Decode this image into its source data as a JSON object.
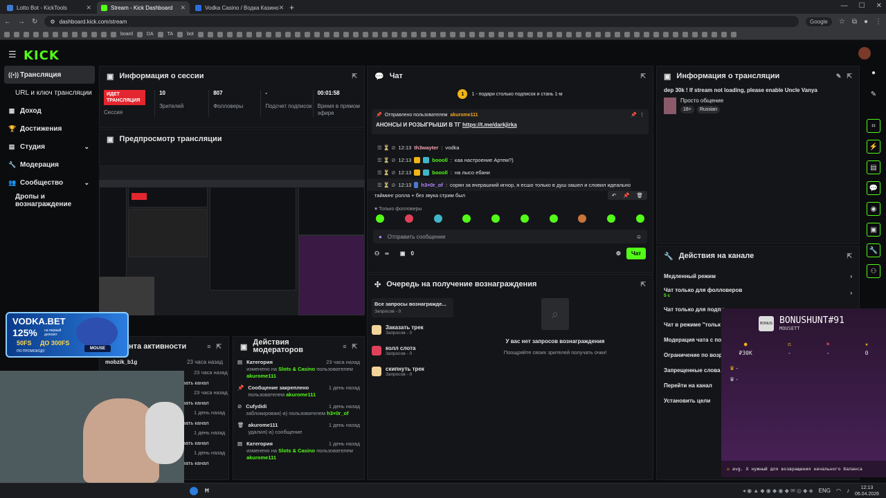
{
  "browser": {
    "tabs": [
      {
        "label": "Lotto Bot - KickTools",
        "color": "#3a7bd5"
      },
      {
        "label": "Stream - Kick Dashboard",
        "color": "#53fc18"
      },
      {
        "label": "Vodka Casino / Водка Казино",
        "color": "#2b6de0"
      }
    ],
    "url": "dashboard.kick.com/stream",
    "search_engine": "Google",
    "bookmarks": [
      "board",
      "DA",
      "TA",
      "bot"
    ]
  },
  "kick": {
    "logo": "KICK"
  },
  "sidebar": {
    "items": [
      {
        "label": "Трансляция",
        "icon": "broadcast-icon",
        "active": true
      },
      {
        "label": "URL и ключ трансляции",
        "icon": "",
        "active": false
      },
      {
        "label": "Доход",
        "icon": "chart-icon",
        "active": false
      },
      {
        "label": "Достижения",
        "icon": "trophy-icon",
        "active": false
      },
      {
        "label": "Студия",
        "icon": "studio-icon",
        "active": false,
        "expand": true
      },
      {
        "label": "Модерация",
        "icon": "wrench-icon",
        "active": false
      },
      {
        "label": "Сообщество",
        "icon": "community-icon",
        "active": false,
        "expand": true
      },
      {
        "label": "Дропы и вознаграждение",
        "icon": "",
        "active": false
      }
    ]
  },
  "session": {
    "title": "Информация о сессии",
    "live_label": "ИДЕТ ТРАНСЛЯЦИЯ",
    "session_label": "Сессия",
    "viewers": "10",
    "viewers_label": "Зрителей",
    "followers": "807",
    "followers_label": "Фолловеры",
    "subs": "-",
    "subs_label": "Подсчет подписок",
    "uptime": "00:01:58",
    "uptime_label": "Время в прямом эфире"
  },
  "preview": {
    "title": "Предпросмотр трансляции"
  },
  "chat": {
    "title": "Чат",
    "goal_text": "1 - подари столько подписок и стань 1-м",
    "goal_num": "1",
    "pinned_by_label": "Отправлено пользователем",
    "pinned_user": "akurome111",
    "pinned_text": "АНОНСЫ И РОЗЫГРЫШИ В ТГ",
    "pinned_link": "https://t.me/darkjirka",
    "messages": [
      {
        "time": "12:13",
        "user": "th3wayter",
        "text": "vodka",
        "color": "#f5a3b5"
      },
      {
        "time": "12:13",
        "user": "boooll",
        "text": "каа настроение Артем?)",
        "color": "#53fc18"
      },
      {
        "time": "12:13",
        "user": "boooll",
        "text": "на лысо ебани",
        "color": "#53fc18"
      },
      {
        "time": "12:13",
        "user": "h3×0r_of",
        "text": "сорян за вчерашний игнор, я есшо только в душ зашел и словил идеально",
        "color": "#b58cff"
      }
    ],
    "continued": "тайминг ролла + без звука стрим был",
    "followers_only": "Только фолловеры",
    "placeholder": "Отправить сообщение",
    "infinity": "∞",
    "count": "0",
    "send_label": "Чат"
  },
  "stream_info": {
    "title": "Информация о трансляции",
    "stream_title": "dep 30k ! If stream not loading, please enable Uncle Vanya",
    "category": "Просто общение",
    "tags": [
      "18+",
      "Russian"
    ]
  },
  "rewards": {
    "title": "Очередь на получение вознаграждения",
    "all_label": "Все запросы вознагражде...",
    "all_sub": "Запросов - 0",
    "items": [
      {
        "label": "Заказать трек",
        "sub": "Запросов - 0",
        "color": "#f1d49a"
      },
      {
        "label": "колл слота",
        "sub": "Запросов - 0",
        "color": "#e0415a"
      },
      {
        "label": "скипнуть трек",
        "sub": "Запросов - 0",
        "color": "#f1d49a"
      }
    ],
    "empty_title": "У вас нет запросов вознаграждения",
    "empty_sub": "Поощряйте своих зрителей получать очки!"
  },
  "activity": {
    "title": "нта активности",
    "first_user": "mobzik_b1g",
    "rows": [
      {
        "time": "23 часа назад",
        "text": "вать канал"
      },
      {
        "time": "23 часа назад",
        "text": "вать канал"
      },
      {
        "time": "1 день назад",
        "text": "вать канал"
      },
      {
        "time": "1 день назад",
        "text": "вать канал"
      },
      {
        "time": "1 день назад",
        "text": "вать канал"
      }
    ],
    "first_time": "23 часа назад"
  },
  "mod_actions": {
    "title": "Действия модераторов",
    "items": [
      {
        "title": "Категория",
        "time": "23 часа назад",
        "l1": "изменено на",
        "hl1": "Slots & Casino",
        "l2": "пользователем",
        "hl2": "akurome111",
        "icon": "category-icon"
      },
      {
        "title": "Сообщение закреплено",
        "time": "1 день назад",
        "l1": "пользователем",
        "hl1": "akurome111",
        "l2": "",
        "hl2": "",
        "icon": "pin-icon"
      },
      {
        "title": "Cufydidi",
        "time": "1 день назад",
        "l1": "заблокирован(-а) пользователем",
        "hl1": "h3×0r_of",
        "l2": "",
        "hl2": "",
        "icon": "ban-icon"
      },
      {
        "title": "akurome111",
        "time": "1 день назад",
        "l1": "удалил(-а) сообщение",
        "hl1": "",
        "l2": "",
        "hl2": "",
        "icon": "trash-icon"
      },
      {
        "title": "Категория",
        "time": "1 день назад",
        "l1": "изменено на",
        "hl1": "Slots & Casino",
        "l2": "пользователем",
        "hl2": "akurome111",
        "icon": "category-icon"
      }
    ]
  },
  "channel_actions": {
    "title": "Действия на канале",
    "items": [
      {
        "label": "Медленный режим",
        "sub": ""
      },
      {
        "label": "Чат только для фолловеров",
        "sub": "5 с"
      },
      {
        "label": "Чат только для подпи",
        "sub": ""
      },
      {
        "label": "Чат в режиме \"тольк",
        "sub": ""
      },
      {
        "label": "Модерация чата с по",
        "sub": ""
      },
      {
        "label": "Ограничение по возра",
        "sub": ""
      },
      {
        "label": "Запрещенные слова",
        "sub": ""
      },
      {
        "label": "Перейти на канал",
        "sub": ""
      },
      {
        "label": "Установить цели",
        "sub": ""
      }
    ]
  },
  "ad": {
    "brand": "VODKA.BET",
    "pct": "125%",
    "line1": "на первый депозит",
    "fs": "50FS",
    "upto": "ДО 300FS",
    "line2": "ПО ПРОМОКОДУ",
    "code": "MOUSE"
  },
  "bonushunt": {
    "title": "BONUSHUNT#91",
    "sub": "MOUSETT",
    "stats": [
      {
        "icon": "coin-icon",
        "value": "₽30K"
      },
      {
        "icon": "scale-icon",
        "value": "-"
      },
      {
        "icon": "cross-icon",
        "value": "-"
      },
      {
        "icon": "star-icon",
        "value": "0"
      }
    ],
    "rows": [
      "-",
      "-"
    ],
    "footer": "avg. X нужный для возвращения начального баланса"
  },
  "taskbar": {
    "lang": "ENG",
    "time": "12:13",
    "date": "06.04.2026"
  }
}
